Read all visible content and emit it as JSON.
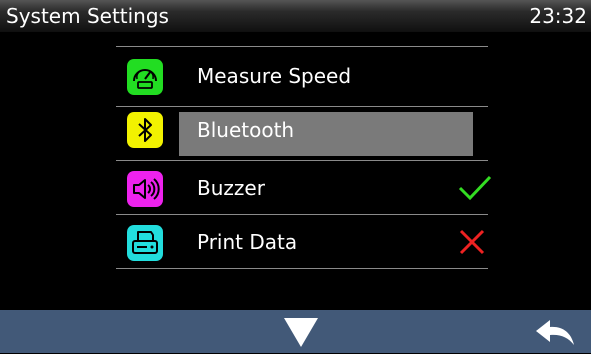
{
  "header": {
    "title": "System Settings",
    "time": "23:32"
  },
  "menu": {
    "items": [
      {
        "label": "Measure Speed",
        "icon": "speedometer-icon",
        "tile_color": "#22dd22",
        "status": null
      },
      {
        "label": "Bluetooth",
        "icon": "bluetooth-icon",
        "tile_color": "#f2f200",
        "status": null,
        "selected": true
      },
      {
        "label": "Buzzer",
        "icon": "speaker-icon",
        "tile_color": "#ee22ee",
        "status": "enabled",
        "status_icon": "check-icon",
        "status_color": "#33dd22"
      },
      {
        "label": "Print Data",
        "icon": "printer-icon",
        "tile_color": "#22dddd",
        "status": "disabled",
        "status_icon": "cross-icon",
        "status_color": "#ee2222"
      }
    ]
  },
  "footer": {
    "buttons": [
      "scroll-down-icon",
      "back-arrow-icon"
    ],
    "bar_color": "#425978"
  }
}
